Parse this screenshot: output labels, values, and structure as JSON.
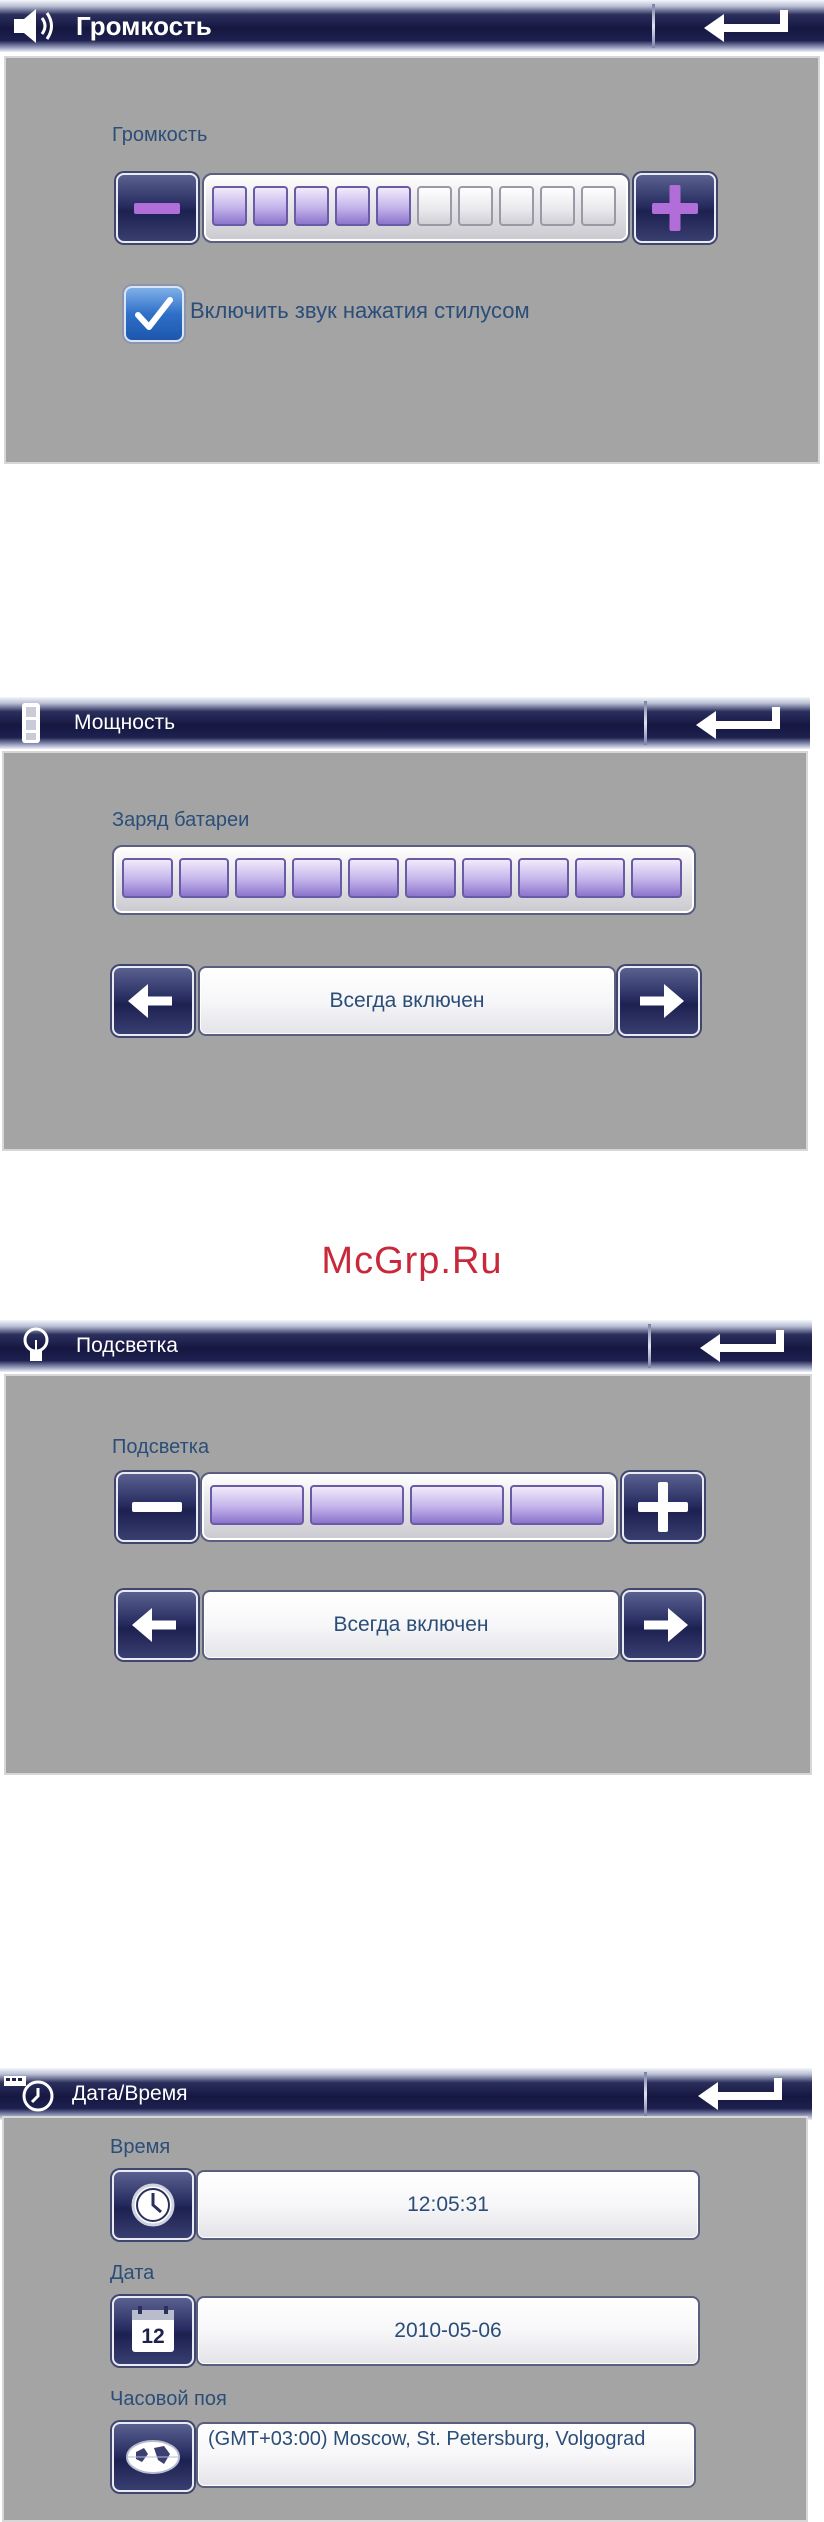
{
  "volume_screen": {
    "title": "Громкость",
    "section_label": "Громкость",
    "level": 5,
    "max_level": 10,
    "stylus_sound_label": "Включить звук нажатия стилусом",
    "stylus_sound_checked": true
  },
  "power_screen": {
    "title": "Мощность",
    "battery_label": "Заряд батареи",
    "battery_level": 10,
    "battery_max": 10,
    "mode_value": "Всегда включен"
  },
  "watermark": "McGrp.Ru",
  "backlight_screen": {
    "title": "Подсветка",
    "section_label": "Подсветка",
    "level": 4,
    "max_level": 4,
    "mode_value": "Всегда включен"
  },
  "datetime_screen": {
    "title": "Дата/Время",
    "time_label": "Время",
    "time_value": "12:05:31",
    "date_label": "Дата",
    "date_value": "2010-05-06",
    "calendar_day": "12",
    "timezone_label": "Часовой поя",
    "timezone_value": "(GMT+03:00) Moscow, St. Petersburg, Volgograd"
  },
  "colors": {
    "panel_bg": "#a4a4a4",
    "title_bar": "#151741",
    "label_text": "#2b4e78",
    "segment_on": "#c3b3ea",
    "watermark": "#c8283a"
  }
}
